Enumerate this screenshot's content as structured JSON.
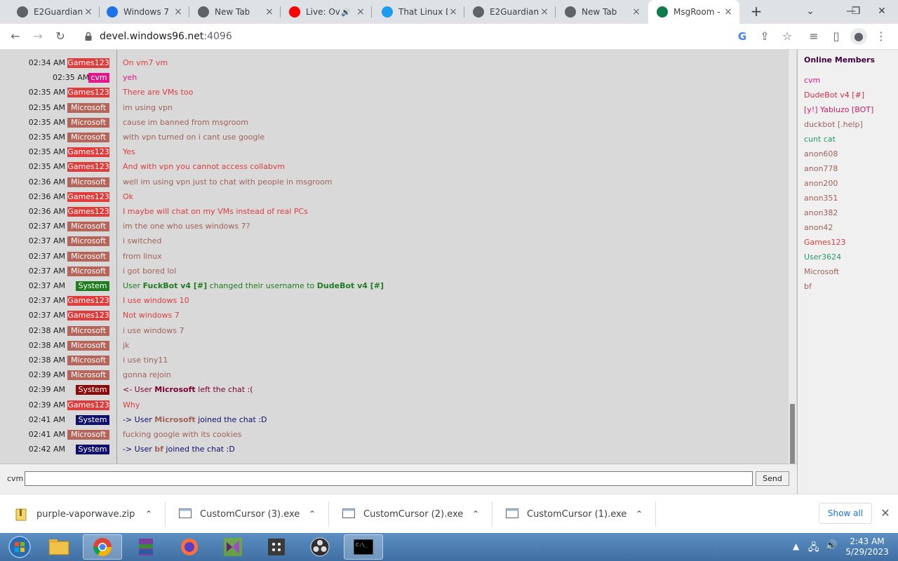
{
  "browser": {
    "tabs": [
      {
        "title": "E2Guardian",
        "favicon": "globe-icon",
        "color": "#5f6368"
      },
      {
        "title": "Windows 7 |",
        "favicon": "edge-icon",
        "color": "#1a73e8"
      },
      {
        "title": "New Tab",
        "favicon": "chrome-icon",
        "color": "#5f6368"
      },
      {
        "title": "Live: Ov",
        "favicon": "youtube-icon",
        "color": "#ff0000"
      },
      {
        "title": "That Linux D",
        "favicon": "twitter-icon",
        "color": "#1d9bf0"
      },
      {
        "title": "E2Guardian",
        "favicon": "globe-icon",
        "color": "#5f6368"
      },
      {
        "title": "New Tab",
        "favicon": "chrome-icon",
        "color": "#5f6368"
      },
      {
        "title": "MsgRoom -",
        "favicon": "msgroom-icon",
        "color": "#0f7b4f"
      }
    ],
    "url_host": "devel.windows96.net",
    "url_port": ":4096"
  },
  "chat": {
    "messages": [
      {
        "time": "02:34 AM",
        "user": "Games123",
        "text": "On vm7 vm",
        "badge_color": "#e03c3c",
        "text_color": "#e03c3c"
      },
      {
        "time": "02:35 AM",
        "user": "cvm",
        "text": "yeh",
        "badge_color": "#e0198a",
        "text_color": "#e0198a"
      },
      {
        "time": "02:35 AM",
        "user": "Games123",
        "text": "There are VMs too",
        "badge_color": "#e03c3c",
        "text_color": "#e03c3c"
      },
      {
        "time": "02:35 AM",
        "user": "Microsoft",
        "text": "im using vpn",
        "badge_color": "#b5655a",
        "text_color": "#a06258"
      },
      {
        "time": "02:35 AM",
        "user": "Microsoft",
        "text": "cause im banned from msgroom",
        "badge_color": "#b5655a",
        "text_color": "#a06258"
      },
      {
        "time": "02:35 AM",
        "user": "Microsoft",
        "text": "with vpn turned on i cant use google",
        "badge_color": "#b5655a",
        "text_color": "#a06258"
      },
      {
        "time": "02:35 AM",
        "user": "Games123",
        "text": "Yes",
        "badge_color": "#e03c3c",
        "text_color": "#e03c3c"
      },
      {
        "time": "02:35 AM",
        "user": "Games123",
        "text": "And with vpn you cannot access collabvm",
        "badge_color": "#e03c3c",
        "text_color": "#e03c3c"
      },
      {
        "time": "02:36 AM",
        "user": "Microsoft",
        "text": "well im using vpn just to chat with people in msgroom",
        "badge_color": "#b5655a",
        "text_color": "#a06258"
      },
      {
        "time": "02:36 AM",
        "user": "Games123",
        "text": "Ok",
        "badge_color": "#e03c3c",
        "text_color": "#e03c3c"
      },
      {
        "time": "02:36 AM",
        "user": "Games123",
        "text": "I maybe will chat on my VMs instead of real PCs",
        "badge_color": "#e03c3c",
        "text_color": "#e03c3c"
      },
      {
        "time": "02:37 AM",
        "user": "Microsoft",
        "text": "im the one who uses windows 7?",
        "badge_color": "#b5655a",
        "text_color": "#a06258"
      },
      {
        "time": "02:37 AM",
        "user": "Microsoft",
        "text": "i switched",
        "badge_color": "#b5655a",
        "text_color": "#a06258"
      },
      {
        "time": "02:37 AM",
        "user": "Microsoft",
        "text": "from linux",
        "badge_color": "#b5655a",
        "text_color": "#a06258"
      },
      {
        "time": "02:37 AM",
        "user": "Microsoft",
        "text": "i got bored lol",
        "badge_color": "#b5655a",
        "text_color": "#a06258"
      },
      {
        "time": "02:37 AM",
        "user": "System",
        "badge_color": "#1e7d1e",
        "text_color": "#1e7d1e",
        "system": true,
        "parts": [
          "User ",
          "FuckBot v4 [#]",
          " changed their username to ",
          "DudeBot v4 [#]"
        ]
      },
      {
        "time": "02:37 AM",
        "user": "Games123",
        "text": "I use windows 10",
        "badge_color": "#e03c3c",
        "text_color": "#e03c3c"
      },
      {
        "time": "02:37 AM",
        "user": "Games123",
        "text": "Not windows 7",
        "badge_color": "#e03c3c",
        "text_color": "#e03c3c"
      },
      {
        "time": "02:38 AM",
        "user": "Microsoft",
        "text": "i use windows 7",
        "badge_color": "#b5655a",
        "text_color": "#a06258"
      },
      {
        "time": "02:38 AM",
        "user": "Microsoft",
        "text": "jk",
        "badge_color": "#b5655a",
        "text_color": "#a06258"
      },
      {
        "time": "02:38 AM",
        "user": "Microsoft",
        "text": "i use tiny11",
        "badge_color": "#b5655a",
        "text_color": "#a06258"
      },
      {
        "time": "02:39 AM",
        "user": "Microsoft",
        "text": "gonna rejoin",
        "badge_color": "#b5655a",
        "text_color": "#a06258"
      },
      {
        "time": "02:39 AM",
        "user": "System",
        "badge_color": "#8b0a0a",
        "text_color": "#7a0030",
        "system": true,
        "parts": [
          "<- User ",
          "Microsoft",
          " left the chat :(",
          ""
        ]
      },
      {
        "time": "02:39 AM",
        "user": "Games123",
        "text": "Why",
        "badge_color": "#e03c3c",
        "text_color": "#e03c3c"
      },
      {
        "time": "02:41 AM",
        "user": "System",
        "badge_color": "#10106b",
        "text_color": "#10106b",
        "system": true,
        "parts": [
          "-> User ",
          "Microsoft",
          " joined the chat :D",
          ""
        ],
        "name_color": "#a06258"
      },
      {
        "time": "02:41 AM",
        "user": "Microsoft",
        "text": "fucking google with its cookies",
        "badge_color": "#b5655a",
        "text_color": "#a06258"
      },
      {
        "time": "02:42 AM",
        "user": "System",
        "badge_color": "#10106b",
        "text_color": "#10106b",
        "system": true,
        "parts": [
          "-> User ",
          "bf",
          " joined the chat :D",
          ""
        ],
        "name_color": "#a06258"
      }
    ],
    "input_nick": "cvm",
    "input_value": "",
    "send_label": "Send"
  },
  "members": {
    "title": "Online Members",
    "list": [
      {
        "name": "cvm",
        "color": "#e0198a"
      },
      {
        "name": "DudeBot v4 [#]",
        "color": "#d0304a"
      },
      {
        "name": "[y!] Yabluzo [BOT]",
        "color": "#d02060"
      },
      {
        "name": "duckbot [.help]",
        "color": "#a06258"
      },
      {
        "name": "cunt cat",
        "color": "#2a9a6a"
      },
      {
        "name": "anon608",
        "color": "#a06258"
      },
      {
        "name": "anon778",
        "color": "#a06258"
      },
      {
        "name": "anon200",
        "color": "#a06258"
      },
      {
        "name": "anon351",
        "color": "#a06258"
      },
      {
        "name": "anon382",
        "color": "#a06258"
      },
      {
        "name": "anon42",
        "color": "#a06258"
      },
      {
        "name": "Games123",
        "color": "#e03c3c"
      },
      {
        "name": "User3624",
        "color": "#2a9a6a"
      },
      {
        "name": "Microsoft",
        "color": "#a06258"
      },
      {
        "name": "bf",
        "color": "#a06258"
      }
    ]
  },
  "downloads": {
    "items": [
      {
        "name": "purple-vaporwave.zip",
        "icon": "zip-file-icon"
      },
      {
        "name": "CustomCursor (3).exe",
        "icon": "exe-file-icon"
      },
      {
        "name": "CustomCursor (2).exe",
        "icon": "exe-file-icon"
      },
      {
        "name": "CustomCursor (1).exe",
        "icon": "exe-file-icon"
      }
    ],
    "show_all_label": "Show all"
  },
  "taskbar": {
    "clock_time": "2:43 AM",
    "clock_date": "5/29/2023",
    "apps": [
      "start-orb-icon",
      "explorer-icon",
      "chrome-icon",
      "winrar-icon",
      "firefox-icon",
      "visual-studio-installer-icon",
      "media-app-icon",
      "obs-icon",
      "cmd-icon"
    ]
  }
}
